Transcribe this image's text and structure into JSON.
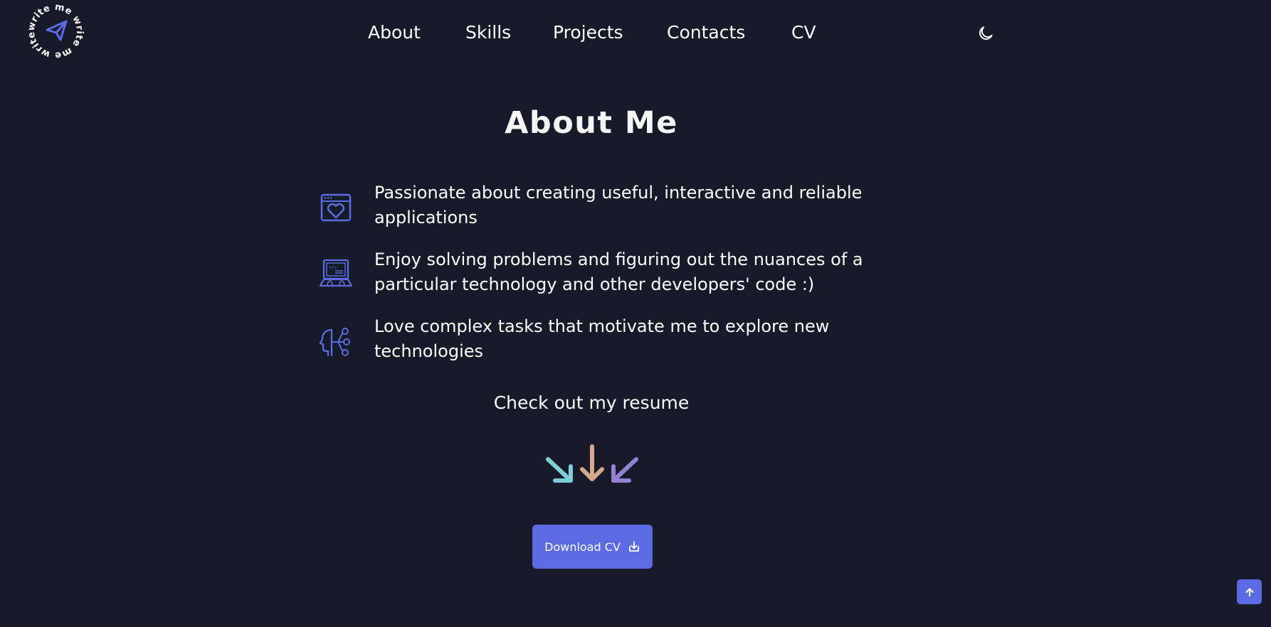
{
  "logo": {
    "ring_text": "write me write me write me",
    "icon": "paper-plane-icon"
  },
  "nav": {
    "items": [
      "About",
      "Skills",
      "Projects",
      "Contacts",
      "CV"
    ],
    "theme_icon": "moon-icon"
  },
  "about": {
    "title": "About Me",
    "items": [
      {
        "icon": "browser-heart-icon",
        "text": "Passionate about creating useful, interactive and reliable applications"
      },
      {
        "icon": "laptop-code-icon",
        "text": "Enjoy solving problems and figuring out the nuances of a particular technology and other developers' code :)"
      },
      {
        "icon": "head-network-icon",
        "text": "Love complex tasks that motivate me to explore new technologies"
      }
    ]
  },
  "resume": {
    "text": "Check out my resume",
    "arrow_colors": [
      "#7ecfd6",
      "#d6a98a",
      "#9382d4"
    ],
    "button_label": "Download CV",
    "button_icon": "download-icon"
  },
  "scroll_top_icon": "arrow-up-icon",
  "colors": {
    "background": "#161a29",
    "accent": "#5b6ce2",
    "text": "#ffffff"
  }
}
